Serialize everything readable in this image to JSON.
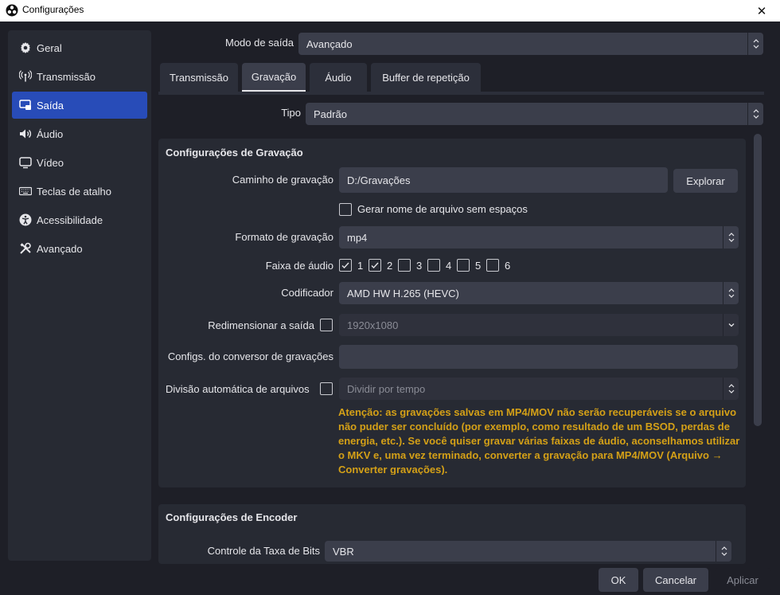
{
  "window": {
    "title": "Configurações",
    "close_glyph": "✕",
    "app_icon": "obs-logo-icon"
  },
  "sidebar": {
    "items": [
      {
        "label": "Geral",
        "icon": "gear-icon",
        "active": false
      },
      {
        "label": "Transmissão",
        "icon": "antenna-icon",
        "active": false
      },
      {
        "label": "Saída",
        "icon": "output-monitor-icon",
        "active": true
      },
      {
        "label": "Áudio",
        "icon": "speaker-icon",
        "active": false
      },
      {
        "label": "Vídeo",
        "icon": "monitor-icon",
        "active": false
      },
      {
        "label": "Teclas de atalho",
        "icon": "keyboard-icon",
        "active": false
      },
      {
        "label": "Acessibilidade",
        "icon": "accessibility-icon",
        "active": false
      },
      {
        "label": "Avançado",
        "icon": "tools-icon",
        "active": false
      }
    ]
  },
  "output_mode": {
    "label": "Modo de saída",
    "value": "Avançado"
  },
  "tabs": [
    {
      "label": "Transmissão",
      "active": false
    },
    {
      "label": "Gravação",
      "active": true
    },
    {
      "label": "Áudio",
      "active": false
    },
    {
      "label": "Buffer de repetição",
      "active": false
    }
  ],
  "type": {
    "label": "Tipo",
    "value": "Padrão"
  },
  "recording": {
    "title": "Configurações de Gravação",
    "path_label": "Caminho de gravação",
    "path_value": "D:/Gravações",
    "browse_label": "Explorar",
    "no_spaces_label": "Gerar nome de arquivo sem espaços",
    "no_spaces_checked": false,
    "format_label": "Formato de gravação",
    "format_value": "mp4",
    "tracks_label": "Faixa de áudio",
    "tracks": [
      {
        "label": "1",
        "checked": true
      },
      {
        "label": "2",
        "checked": true
      },
      {
        "label": "3",
        "checked": false
      },
      {
        "label": "4",
        "checked": false
      },
      {
        "label": "5",
        "checked": false
      },
      {
        "label": "6",
        "checked": false
      }
    ],
    "encoder_label": "Codificador",
    "encoder_value": "AMD HW H.265 (HEVC)",
    "rescale_label": "Redimensionar a saída",
    "rescale_checked": false,
    "rescale_value": "1920x1080",
    "muxer_label": "Configs. do conversor de gravações",
    "muxer_value": "",
    "split_label": "Divisão automática de arquivos",
    "split_checked": false,
    "split_value": "Dividir por tempo",
    "warning": "Atenção: as gravações salvas em MP4/MOV não serão recuperáveis se o arquivo não puder ser concluído (por exemplo, como resultado de um BSOD, perdas de energia, etc.). Se você quiser gravar várias faixas de áudio, aconselhamos utilizar o MKV e, uma vez terminado, converter a gravação para MP4/MOV (Arquivo → Converter gravações)."
  },
  "encoder": {
    "title": "Configurações de Encoder",
    "rate_control_label": "Controle da Taxa de Bits",
    "rate_control_value": "VBR"
  },
  "footer": {
    "ok": "OK",
    "cancel": "Cancelar",
    "apply": "Aplicar"
  },
  "colors": {
    "accent": "#284cb8",
    "warning": "#d4a017",
    "background": "#1e1f27",
    "panel": "#272a33"
  }
}
